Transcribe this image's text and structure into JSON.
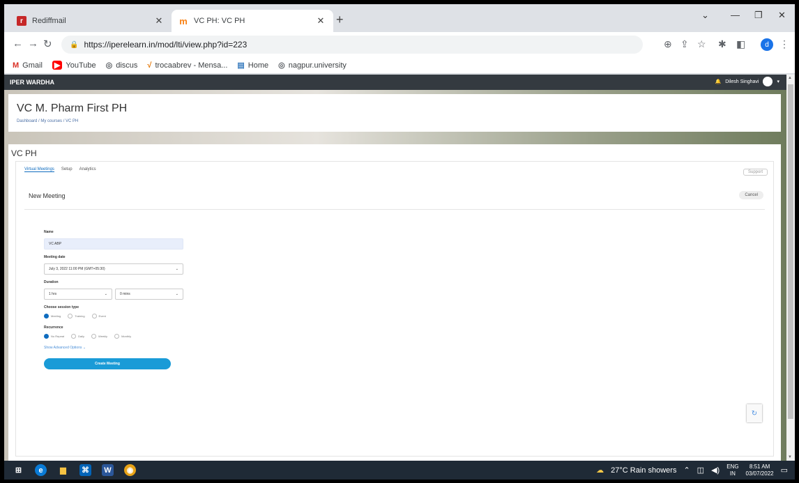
{
  "browser": {
    "tabs": [
      {
        "title": "Rediffmail",
        "icon": "rediff-icon",
        "active": false
      },
      {
        "title": "VC PH: VC PH",
        "icon": "moodle-icon",
        "active": true
      }
    ],
    "url": "https://iperelearn.in/mod/lti/view.php?id=223",
    "profile_initial": "d",
    "bookmarks": [
      {
        "label": "Gmail",
        "icon": "gmail-icon"
      },
      {
        "label": "YouTube",
        "icon": "youtube-icon"
      },
      {
        "label": "discus",
        "icon": "globe-icon"
      },
      {
        "label": "trocaabrev - Mensa...",
        "icon": "brand-icon"
      },
      {
        "label": "Home",
        "icon": "home-icon"
      },
      {
        "label": "nagpur.university",
        "icon": "globe-icon"
      }
    ]
  },
  "site": {
    "name": "IPER WARDHA",
    "user_name": "Dilesh Singhavi"
  },
  "course": {
    "title": "VC M. Pharm First PH",
    "breadcrumb": "Dashboard / My courses / VC PH"
  },
  "activity": {
    "title": "VC PH",
    "tabs": [
      "Virtual Meetings",
      "Setup",
      "Analytics"
    ],
    "support_label": "Support",
    "section_title": "New Meeting",
    "cancel_label": "Cancel"
  },
  "form": {
    "name_label": "Name",
    "name_value": "VC ABP",
    "date_label": "Meeting date",
    "date_value": "July 3, 2022 11:00 PM (GMT+05:30)",
    "duration_label": "Duration",
    "duration_hours": "1 hrs",
    "duration_mins": "0 mins",
    "session_type_label": "Choose session type",
    "session_types": [
      "Meeting",
      "Training",
      "Event"
    ],
    "selected_session_type": "Meeting",
    "recurrence_label": "Recurrence",
    "recurrence_options": [
      "No Repeat",
      "Daily",
      "Weekly",
      "Monthly"
    ],
    "selected_recurrence": "No Repeat",
    "advanced_link": "Show Advanced Options",
    "create_button": "Create Meeting"
  },
  "taskbar": {
    "weather": "27°C  Rain showers",
    "lang": "ENG",
    "region": "IN",
    "time": "8:51 AM",
    "date": "03/07/2022"
  }
}
